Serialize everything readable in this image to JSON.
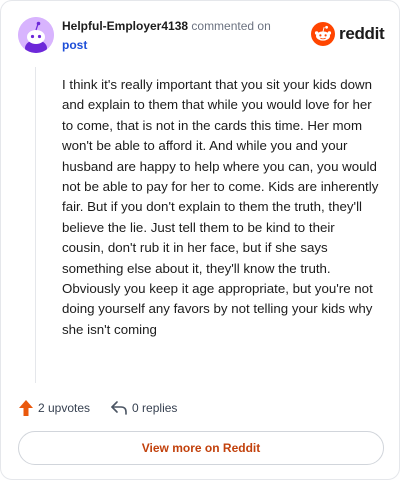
{
  "header": {
    "author": "Helpful-Employer4138",
    "commented_on": "commented on",
    "post_link": "post"
  },
  "logo": {
    "icon": "reddit-alien-icon",
    "wordmark": "reddit",
    "brand_color": "#ff4500"
  },
  "avatar": {
    "icon": "snoo-avatar-icon",
    "color": "#d8b4fe"
  },
  "comment": {
    "body": "I think it's really important that you sit your kids down and explain to them that while you would love for her to come, that is not in the cards this time. Her mom won't be able to afford it. And while you and your husband are happy to help where you can, you would not be able to pay for her to come. Kids are inherently fair. But if you don't explain to them the truth, they'll believe the lie. Just tell them to be kind to their cousin, don't rub it in her face, but if she says something else about it, they'll know the truth. Obviously you keep it age appropriate, but you're not doing yourself any favors by not telling your kids why she isn't coming"
  },
  "footer": {
    "upvotes": "2 upvotes",
    "replies": "0 replies",
    "upvote_icon": "upvote-arrow-icon",
    "reply_icon": "reply-arrow-icon",
    "upvote_color": "#ea580c"
  },
  "cta": {
    "label": "View more on Reddit",
    "color": "#c2410c"
  }
}
